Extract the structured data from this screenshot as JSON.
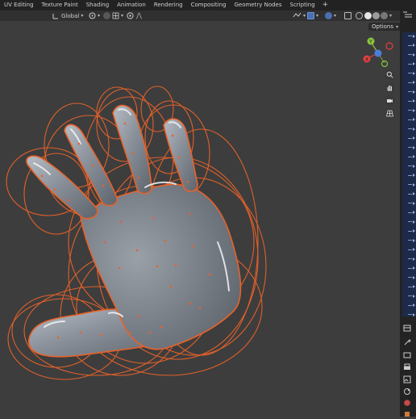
{
  "workspace_tabs": [
    {
      "label": "UV Editing"
    },
    {
      "label": "Texture Paint"
    },
    {
      "label": "Shading"
    },
    {
      "label": "Animation"
    },
    {
      "label": "Rendering"
    },
    {
      "label": "Compositing"
    },
    {
      "label": "Geometry Nodes"
    },
    {
      "label": "Scripting"
    }
  ],
  "add_workspace_label": "+",
  "header": {
    "transform_orientation": "Global",
    "options_label": "Options"
  },
  "gizmo": {
    "axis_x_label": "X",
    "axis_y_label": "Y",
    "axis_z_label": "Z",
    "colors": {
      "x": "#e0413f",
      "y": "#8ac53b",
      "z": "#4a7fd8"
    }
  },
  "icons": {
    "transform_pivot": "pivot-icon",
    "snap": "magnet-icon",
    "proportional": "proportional-editing-icon",
    "zoom": "zoom-icon",
    "pan": "hand-icon",
    "camera": "camera-icon",
    "perspective": "grid-perspective-icon"
  },
  "colors": {
    "accent_orange": "#e8622a",
    "viewport_bg": "#3d3d3d",
    "outliner_blue": "#1d2a4a"
  }
}
